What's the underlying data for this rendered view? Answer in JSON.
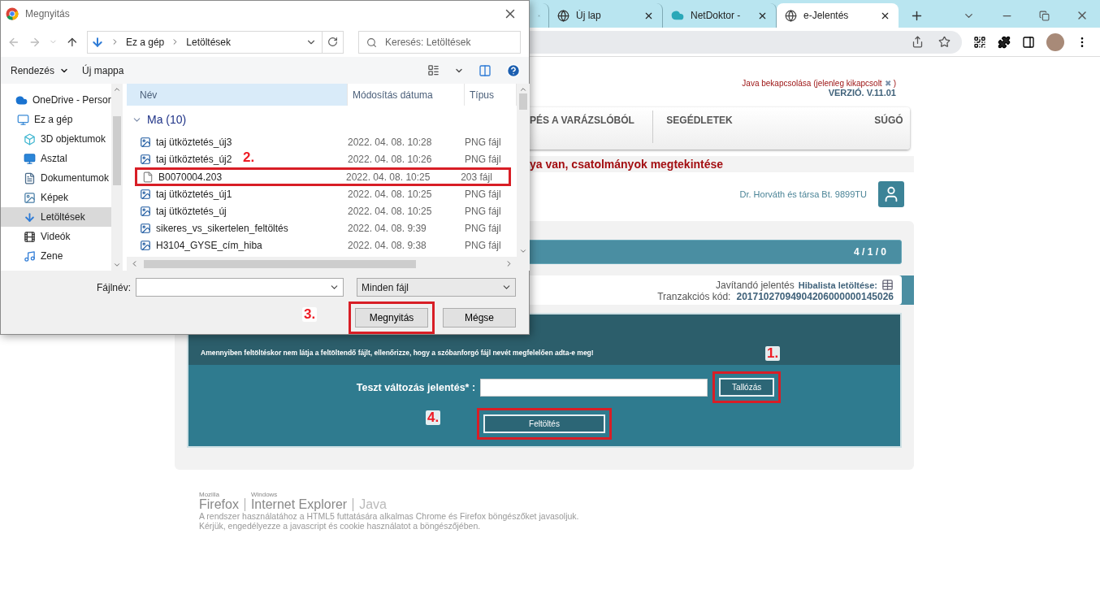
{
  "browser": {
    "tabs": [
      {
        "kind": "hidden",
        "selected": false
      },
      {
        "kind": "chrome",
        "title": "Új lap",
        "selected": false
      },
      {
        "kind": "cloud",
        "title": "NetDoktor - ",
        "selected": false
      },
      {
        "kind": "globe",
        "title": "e-Jelentés",
        "selected": true
      }
    ]
  },
  "page": {
    "java_notice": [
      "Java bekapcsolása (jelenleg kikapcsolt",
      "✖",
      ")"
    ],
    "version": "VERZIÓ. V.11.01",
    "menu": [
      "PÉS A VARÁZSLÓBÓL",
      "SEGÉDLETEK",
      "SÚGÓ"
    ],
    "title": "ya van, csatolmányok megtekintése",
    "company": "Dr. Horváth és társa Bt. 9899TU",
    "counter": "4 / 1 / 0",
    "report_status": "Javítandó jelentés",
    "error_list": "Hibalista letöltése:",
    "transaction_label": "Tranzakciós kód:",
    "transaction_code": "20171027094904206000000145026",
    "notice": "Amennyiben feltöltéskor nem látja a feltöltendő fájlt, ellenőrizze, hogy a szóbanforgó fájl nevét megfelelően adta-e meg!",
    "upload_label": "Teszt változás jelentés* :",
    "browse": {
      "label": "Tallózás",
      "callout": "1."
    },
    "upload": {
      "label": "Feltöltés",
      "callout": "4."
    }
  },
  "footer": {
    "logos": [
      {
        "small": "Mozilla",
        "name": "Firefox"
      },
      {
        "small": "Windows",
        "name": "Internet Explorer"
      },
      {
        "name": "Java"
      }
    ],
    "lines": [
      "A rendszer használatához a HTML5 futtatására alkalmas Chrome és Firefox böngészőket javasoljuk.",
      "Kérjük, engedélyezze a javascript és cookie használatot a böngészőjében."
    ]
  },
  "dialog": {
    "title": "Megnyitás",
    "path": [
      "Ez a gép",
      "Letöltések"
    ],
    "search": {
      "placeholder": "Keresés: Letöltések"
    },
    "toolbar": [
      "Rendezés",
      "Új mappa"
    ],
    "nav_items": [
      {
        "label": "OneDrive - Persor",
        "kind": "cloud",
        "selected": false
      },
      {
        "label": "Ez a gép",
        "kind": "pc",
        "selected": false
      },
      {
        "label": "3D objektumok",
        "kind": "cube",
        "selected": false
      },
      {
        "label": "Asztal",
        "kind": "desktop",
        "selected": false
      },
      {
        "label": "Dokumentumok",
        "kind": "document",
        "selected": false
      },
      {
        "label": "Képek",
        "kind": "pictures",
        "selected": false
      },
      {
        "label": "Letöltések",
        "kind": "download",
        "selected": true
      },
      {
        "label": "Videók",
        "kind": "video",
        "selected": false
      },
      {
        "label": "Zene",
        "kind": "music",
        "selected": false
      }
    ],
    "columns": [
      "Név",
      "Módosítás dátuma",
      "Típus"
    ],
    "group": "Ma (10)",
    "files": [
      {
        "name": "taj ütköztetés_új3",
        "date": "2022. 04. 08. 10:28",
        "type": "PNG fájl",
        "kind": "image"
      },
      {
        "name": "taj ütköztetés_új2",
        "date": "2022. 04. 08. 10:26",
        "type": "PNG fájl",
        "kind": "image"
      },
      {
        "name": "B0070004.203",
        "date": "2022. 04. 08. 10:25",
        "type": "203 fájl",
        "kind": "file",
        "callout": "2."
      },
      {
        "name": "taj ütköztetés_új1",
        "date": "2022. 04. 08. 10:25",
        "type": "PNG fájl",
        "kind": "image"
      },
      {
        "name": "taj ütköztetés_új",
        "date": "2022. 04. 08. 10:25",
        "type": "PNG fájl",
        "kind": "image"
      },
      {
        "name": "sikeres_vs_sikertelen_feltöltés",
        "date": "2022. 04. 08. 9:39",
        "type": "PNG fájl",
        "kind": "image"
      },
      {
        "name": "H3104_GYSE_cím_hiba",
        "date": "2022. 04. 08. 9:38",
        "type": "PNG fájl",
        "kind": "image"
      }
    ],
    "filename_label": "Fájlnév:",
    "filter": "Minden fájl",
    "buttons": [
      {
        "label": "Megnyitás",
        "callout": "3."
      },
      {
        "label": "Mégse"
      }
    ]
  }
}
